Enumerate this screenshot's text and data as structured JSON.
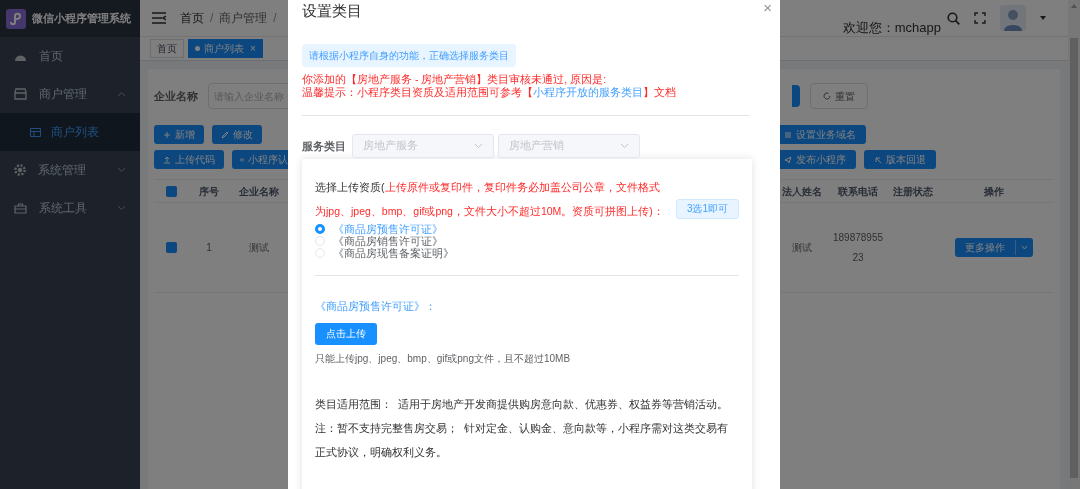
{
  "app": {
    "title": "微信小程序管理系统"
  },
  "sidebar": {
    "items": [
      {
        "label": "首页"
      },
      {
        "label": "商户管理",
        "expanded": true,
        "children": [
          {
            "label": "商户列表",
            "selected": true
          }
        ]
      },
      {
        "label": "系统管理",
        "expanded": false
      },
      {
        "label": "系统工具",
        "expanded": false
      }
    ]
  },
  "header": {
    "breadcrumb": [
      {
        "kind": "link",
        "label": "首页"
      },
      {
        "kind": "separator",
        "label": "/"
      },
      {
        "kind": "link",
        "label": "商户管理"
      },
      {
        "kind": "separator",
        "label": "/"
      }
    ],
    "welcome": "欢迎您：mchapp"
  },
  "tags": [
    {
      "label": "首页",
      "selected": false
    },
    {
      "label": "商户列表",
      "selected": true,
      "close": "×"
    }
  ],
  "search": {
    "label": "企业名称",
    "placeholder": "请输入企业名称",
    "reset": "重置"
  },
  "toolbar_left": [
    [
      "新增",
      "修改"
    ],
    [
      "上传代码",
      "小程序认"
    ]
  ],
  "toolbar_right": [
    [
      "设置业务域名"
    ],
    [
      "发布小程序",
      "版本回退"
    ]
  ],
  "table": {
    "columns": [
      "序号",
      "企业名称",
      "法人姓名",
      "联系电话",
      "注册状态",
      "操作"
    ],
    "rows": [
      {
        "selected": true,
        "index": "1",
        "company": "测试",
        "legal_person": "测试",
        "phone": "18987895523",
        "action": "更多操作"
      }
    ]
  },
  "header_checkbox": {
    "checked": true
  },
  "dialog": {
    "title": "设置类目",
    "close": "×",
    "alert": "请根据小程序自身的功能，正确选择服务类目",
    "error": "你添加的【房地产服务 - 房地产营销】类目审核未通过, 原因是:",
    "tip": {
      "before": "温馨提示：小程序类目资质及适用范围可参考【",
      "link": "小程序开放的服务类目",
      "after": "】文档"
    },
    "category": {
      "label": "服务类目",
      "selects": [
        "房地产服务",
        "房地产营销"
      ]
    },
    "upload": {
      "label": "选择上传资质(",
      "requirement": "上传原件或复印件，复印件务必加盖公司公章，文件格式为jpg、jpeg、bmp、gif或png，文件大小不超过10M。资质可拼图上传)：",
      "tag": "3选1即可",
      "options": [
        {
          "label": "《商品房预售许可证》",
          "selected": true
        },
        {
          "label": "《商品房销售许可证》",
          "selected": false
        },
        {
          "label": "《商品房现售备案证明》",
          "selected": false
        }
      ],
      "current": "《商品房预售许可证》：",
      "button": "点击上传",
      "hint": "只能上传jpg、jpeg、bmp、gif或png文件，且不超过10MB"
    },
    "scope": "类目适用范围：  适用于房地产开发商提供购房意向款、优惠券、权益券等营销活动。注：暂不支持完整售房交易；  针对定金、认购金、意向款等，小程序需对这类交易有正式协议，明确权利义务。"
  }
}
